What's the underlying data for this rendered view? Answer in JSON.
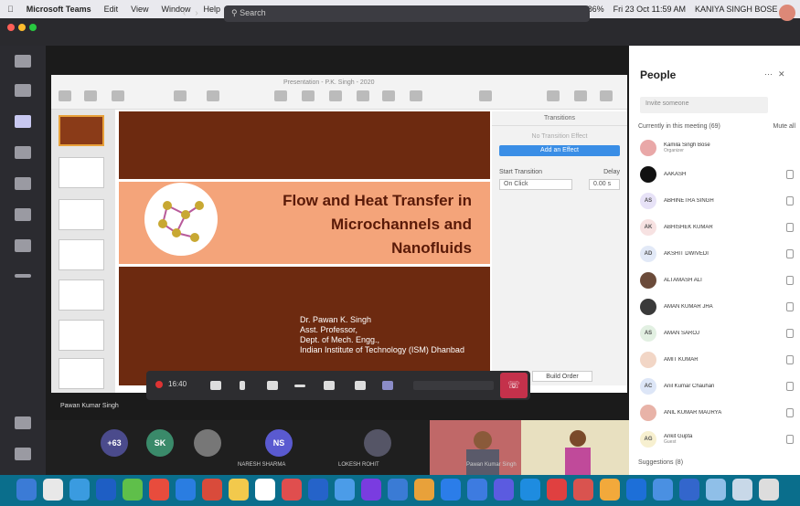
{
  "menubar": {
    "app": "Microsoft Teams",
    "items": [
      "Edit",
      "View",
      "Window",
      "Help"
    ],
    "status": "Fri 23 Oct  11:59 AM",
    "battery": "86%",
    "user": "KANIYA SINGH BOSE"
  },
  "titlebar": {
    "search_placeholder": "Search"
  },
  "ppt": {
    "window_title": "Presentation - P.K. Singh - 2020"
  },
  "slide": {
    "title": "Flow and Heat Transfer in\nMicrochannels and\nNanofluids",
    "author": "Dr. Pawan K. Singh\nAsst. Professor,\nDept. of Mech. Engg.,\nIndian Institute of Technology (ISM) Dhanbad"
  },
  "transitions": {
    "header": "Transitions",
    "none": "No Transition Effect",
    "add_button": "Add an Effect",
    "start_label": "Start Transition",
    "delay_label": "Delay",
    "start_value": "On Click",
    "delay_value": "0.00 s",
    "build_order": "Build Order"
  },
  "callbar": {
    "timer": "16:40"
  },
  "presenter_name": "Pawan Kumar Singh",
  "gallery": [
    {
      "initials": "+63",
      "label": ""
    },
    {
      "initials": "SK",
      "label": ""
    },
    {
      "initials": "",
      "label": ""
    },
    {
      "initials": "NS",
      "label": "NARESH SHARMA"
    },
    {
      "initials": "",
      "label": "LOKESH ROHIT"
    }
  ],
  "video_label": "Pawan Kumar Singh",
  "people": {
    "title": "People",
    "invite_placeholder": "Invite someone",
    "in_meeting": "Currently in this meeting (69)",
    "mute_all": "Mute all",
    "suggestions": "Suggestions (8)",
    "participants": [
      {
        "name": "Kamila Singh Bose",
        "role": "Organizer",
        "initials": "",
        "color": "#e9a8a8"
      },
      {
        "name": "AAKASH",
        "role": "",
        "initials": "",
        "color": "#111111"
      },
      {
        "name": "ABHINETRA SINGH",
        "role": "",
        "initials": "AS",
        "color": "#e7e2f7"
      },
      {
        "name": "ABHISHEK KUMAR",
        "role": "",
        "initials": "AK",
        "color": "#f7e2e2"
      },
      {
        "name": "AKSHIT DWIVEDI",
        "role": "",
        "initials": "AD",
        "color": "#e2e9f7"
      },
      {
        "name": "ALTAMASH ALI",
        "role": "",
        "initials": "",
        "color": "#6b4b3a"
      },
      {
        "name": "AMAN KUMAR JHA",
        "role": "",
        "initials": "",
        "color": "#3a3a3a"
      },
      {
        "name": "AMAN SAROJ",
        "role": "",
        "initials": "AS",
        "color": "#e2f0e2"
      },
      {
        "name": "AMIT KUMAR",
        "role": "",
        "initials": "",
        "color": "#f2d6c6"
      },
      {
        "name": "Anil Kumar Chauhan",
        "role": "",
        "initials": "AC",
        "color": "#dde6f7"
      },
      {
        "name": "ANIL KUMAR MAURYA",
        "role": "",
        "initials": "",
        "color": "#e8b3a8"
      },
      {
        "name": "Ankit Gupta",
        "role": "Guest",
        "initials": "AG",
        "color": "#f7f0d0"
      }
    ]
  },
  "dock_colors": [
    "#3b7bd6",
    "#e8e8e8",
    "#3a9be0",
    "#1e5ec4",
    "#5fbf4a",
    "#e84c3d",
    "#2a7de1",
    "#d94b3b",
    "#f2c94c",
    "#fff",
    "#e04e4e",
    "#2563c9",
    "#4b9ce8",
    "#7a3ce0",
    "#3a7bd5",
    "#e8a13a",
    "#2b7de9",
    "#3d7be0",
    "#5b5be0",
    "#1e8ce0",
    "#e04040",
    "#d9534f",
    "#f2a93b",
    "#1d6fd8",
    "#4a90e2",
    "#3366cc",
    "#8fbfe8",
    "#c8d8e8",
    "#ddd"
  ]
}
